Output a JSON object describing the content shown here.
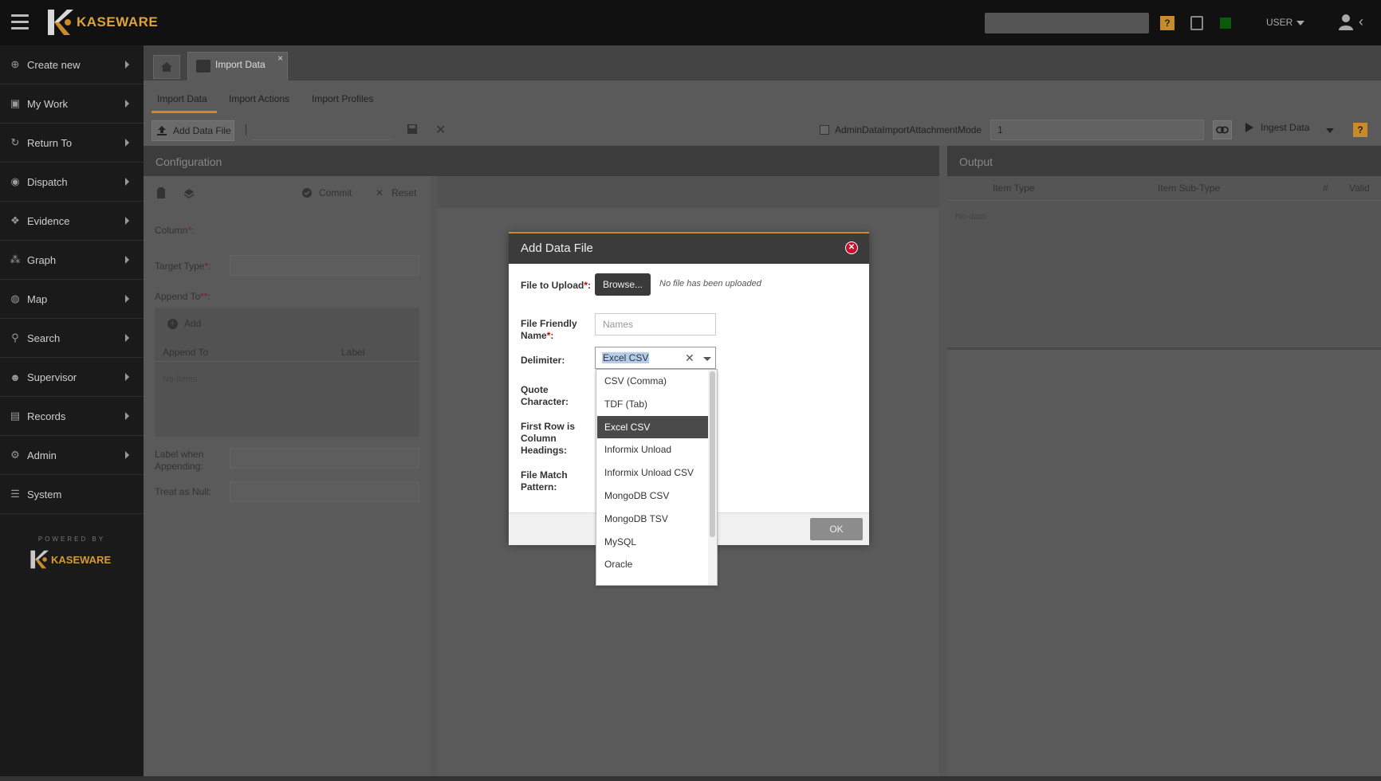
{
  "app": {
    "brand": "KASEWARE",
    "powered_by": "POWERED BY",
    "user_label": "USER",
    "help": "?"
  },
  "sidebar": {
    "items": [
      {
        "label": "Create new",
        "icon": "plus-circle-icon"
      },
      {
        "label": "My Work",
        "icon": "briefcase-icon"
      },
      {
        "label": "Return To",
        "icon": "refresh-icon"
      },
      {
        "label": "Dispatch",
        "icon": "map-pin-icon"
      },
      {
        "label": "Evidence",
        "icon": "evidence-icon"
      },
      {
        "label": "Graph",
        "icon": "graph-icon"
      },
      {
        "label": "Map",
        "icon": "globe-icon"
      },
      {
        "label": "Search",
        "icon": "search-icon"
      },
      {
        "label": "Supervisor",
        "icon": "users-icon"
      },
      {
        "label": "Records",
        "icon": "document-icon"
      },
      {
        "label": "Admin",
        "icon": "gears-icon"
      },
      {
        "label": "System",
        "icon": "list-icon"
      }
    ]
  },
  "tabs": {
    "doc_tab": "Import Data"
  },
  "subtabs": [
    "Import Data",
    "Import Actions",
    "Import Profiles"
  ],
  "toolbar": {
    "add_file": "Add Data File",
    "attachment_mode_label": "AdminDataImportAttachmentMode",
    "attachment_mode_value": "1",
    "ingest": "Ingest Data"
  },
  "config": {
    "title": "Configuration",
    "commit": "Commit",
    "reset": "Reset",
    "column_label": "Column",
    "target_type_label": "Target Type",
    "append_to_label": "Append To",
    "add": "Add",
    "append_to_col": "Append To",
    "label_col": "Label",
    "no_items": "No items",
    "label_when_appending": "Label when Appending:",
    "treat_as_null": "Treat as Null:"
  },
  "output": {
    "title": "Output",
    "columns": [
      "Item Type",
      "Item Sub-Type",
      "#",
      "Valid"
    ],
    "no_data": "No data"
  },
  "modal": {
    "title": "Add Data File",
    "file_to_upload": "File to Upload",
    "browse": "Browse...",
    "no_file": "No file has been uploaded",
    "friendly_name": "File Friendly Name",
    "friendly_placeholder": "Names",
    "delimiter": "Delimiter:",
    "delimiter_value": "Excel CSV",
    "quote_character": "Quote Character:",
    "first_row": "First Row is Column Headings:",
    "file_match": "File Match Pattern:",
    "ok": "OK"
  },
  "dropdown": {
    "options": [
      "CSV (Comma)",
      "TDF (Tab)",
      "Excel CSV",
      "Informix Unload",
      "Informix Unload CSV",
      "MongoDB CSV",
      "MongoDB TSV",
      "MySQL",
      "Oracle"
    ],
    "selected": "Excel CSV"
  },
  "colors": {
    "accent": "#c98a2a",
    "close_red": "#c8102e"
  }
}
